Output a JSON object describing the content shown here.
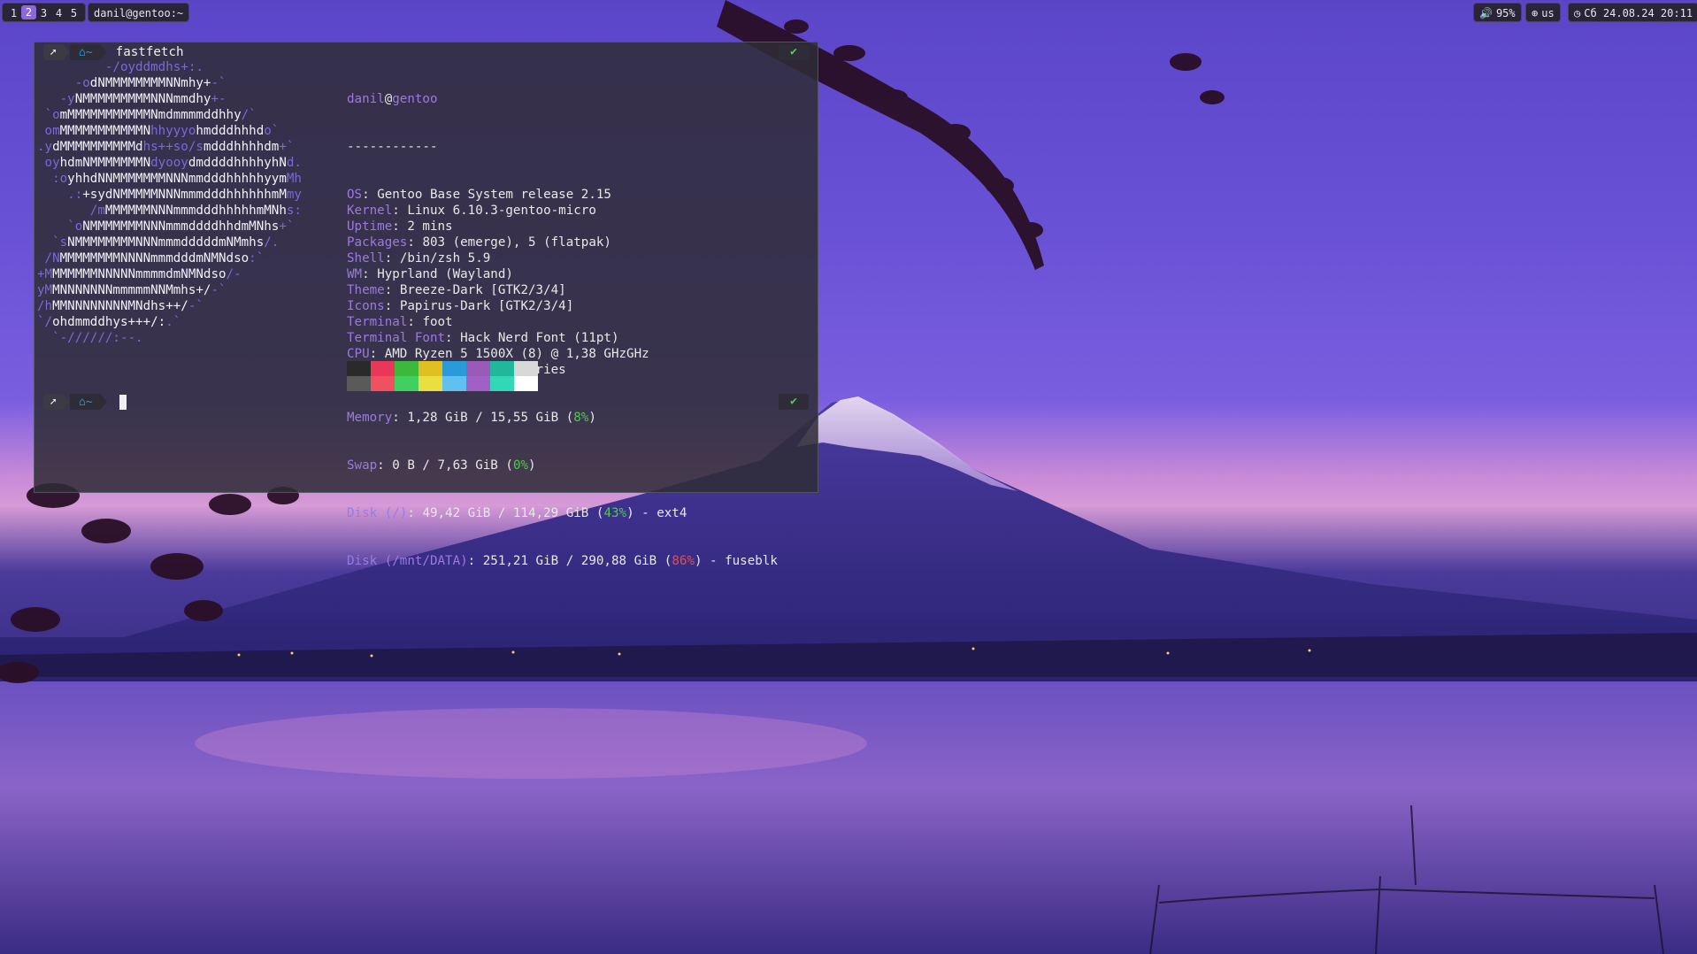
{
  "topbar": {
    "workspaces": [
      "1",
      "2",
      "3",
      "4",
      "5"
    ],
    "active_workspace": "2",
    "window_title": "danil@gentoo:~",
    "volume": "95%",
    "keyboard_layout": "us",
    "clock": "Сб 24.08.24 20:11",
    "icons": {
      "volume": "speaker-icon",
      "keyboard": "globe-icon",
      "clock": "clock-icon"
    }
  },
  "terminal": {
    "command": "fastfetch",
    "prompt_home": "~",
    "user_host": {
      "user": "danil",
      "at": "@",
      "host": "gentoo"
    },
    "separator": "------------",
    "info": [
      {
        "key": "OS",
        "value": "Gentoo Base System release 2.15"
      },
      {
        "key": "Kernel",
        "value": "Linux 6.10.3-gentoo-micro"
      },
      {
        "key": "Uptime",
        "value": "2 mins"
      },
      {
        "key": "Packages",
        "value": "803 (emerge), 5 (flatpak)"
      },
      {
        "key": "Shell",
        "value": "/bin/zsh 5.9"
      },
      {
        "key": "WM",
        "value": "Hyprland (Wayland)"
      },
      {
        "key": "Theme",
        "value": "Breeze-Dark [GTK2/3/4]"
      },
      {
        "key": "Icons",
        "value": "Papirus-Dark [GTK2/3/4]"
      },
      {
        "key": "Terminal",
        "value": "foot"
      },
      {
        "key": "Terminal Font",
        "value": "Hack Nerd Font (11pt)"
      },
      {
        "key": "CPU",
        "value": "AMD Ryzen 5 1500X (8) @ 1,38 GHzGHz"
      },
      {
        "key": "GPU",
        "value": "AMD Radeon RX 570 Series"
      }
    ],
    "memory": {
      "key": "Memory",
      "pre": "1,28 GiB / 15,55 GiB (",
      "pct": "8%",
      "post": ")"
    },
    "swap": {
      "key": "Swap",
      "pre": "0 B / 7,63 GiB (",
      "pct": "0%",
      "post": ")"
    },
    "disk_root": {
      "key": "Disk (/)",
      "pre": "49,42 GiB / 114,29 GiB (",
      "pct": "43%",
      "post": ") - ext4"
    },
    "disk_data": {
      "key": "Disk (/mnt/DATA)",
      "pre": "251,21 GiB / 290,88 GiB (",
      "pct": "86%",
      "post": ") - fuseblk"
    },
    "palette": {
      "top": [
        "#2a2a2a",
        "#e8385a",
        "#3cb83c",
        "#e0c020",
        "#2a9ad8",
        "#9a5ab8",
        "#20b89a",
        "#d8d8d8"
      ],
      "bottom": [
        "#5a5a5a",
        "#f05060",
        "#40d060",
        "#e8e040",
        "#60c0f0",
        "#a060c8",
        "#30d8b8",
        "#ffffff"
      ]
    },
    "logo_lines": [
      [
        [
          "         -/oyddmdhs+:.",
          "p"
        ]
      ],
      [
        [
          "     -o",
          "p"
        ],
        [
          "dNMMMMMMMMNNmhy+",
          "w"
        ],
        [
          "-`",
          "p"
        ]
      ],
      [
        [
          "   -y",
          "p"
        ],
        [
          "NMMMMMMMMMNNNmmdhy",
          "w"
        ],
        [
          "+-",
          "p"
        ]
      ],
      [
        [
          " `o",
          "p"
        ],
        [
          "mMMMMMMMMMMMNmdmmmmddhhy",
          "w"
        ],
        [
          "/`",
          "p"
        ]
      ],
      [
        [
          " om",
          "p"
        ],
        [
          "MMMMMMMMMMMN",
          "w"
        ],
        [
          "hhyyyo",
          "p"
        ],
        [
          "hmdddhhhd",
          "w"
        ],
        [
          "o`",
          "p"
        ]
      ],
      [
        [
          ".y",
          "p"
        ],
        [
          "dMMMMMMMMMMd",
          "w"
        ],
        [
          "hs++so/s",
          "p"
        ],
        [
          "mdddhhhhdm",
          "w"
        ],
        [
          "+`",
          "p"
        ]
      ],
      [
        [
          " oy",
          "p"
        ],
        [
          "hdmNMMMMMMMN",
          "w"
        ],
        [
          "dyooy",
          "p"
        ],
        [
          "dmddddhhhhyhN",
          "w"
        ],
        [
          "d.",
          "p"
        ]
      ],
      [
        [
          "  :o",
          "p"
        ],
        [
          "yhhdNNMMMMMMMNNNmmdddhhhhhyym",
          "w"
        ],
        [
          "Mh",
          "p"
        ]
      ],
      [
        [
          "    .:",
          "p"
        ],
        [
          "+sydNMMMMMNNNmmmdddhhhhhhmM",
          "w"
        ],
        [
          "my",
          "p"
        ]
      ],
      [
        [
          "       /m",
          "p"
        ],
        [
          "MMMMMMNNNmmmdddhhhhhmMNh",
          "w"
        ],
        [
          "s:",
          "p"
        ]
      ],
      [
        [
          "    `o",
          "p"
        ],
        [
          "NMMMMMMMNNNmmmddddhhdmMNhs",
          "w"
        ],
        [
          "+`",
          "p"
        ]
      ],
      [
        [
          "  `s",
          "p"
        ],
        [
          "NMMMMMMMMNNNmmmdddddmNMmhs",
          "w"
        ],
        [
          "/.",
          "p"
        ]
      ],
      [
        [
          " /N",
          "p"
        ],
        [
          "MMMMMMMMNNNNmmmdddmNMNdso",
          "w"
        ],
        [
          ":`",
          "p"
        ]
      ],
      [
        [
          "+M",
          "p"
        ],
        [
          "MMMMMMNNNNNmmmmdmNMNdso",
          "w"
        ],
        [
          "/-",
          "p"
        ]
      ],
      [
        [
          "yM",
          "p"
        ],
        [
          "MNNNNNNNmmmmmNNMmhs+/",
          "w"
        ],
        [
          "-`",
          "p"
        ]
      ],
      [
        [
          "/h",
          "p"
        ],
        [
          "MMNNNNNNNNMNdhs++/",
          "w"
        ],
        [
          "-`",
          "p"
        ]
      ],
      [
        [
          "`/",
          "p"
        ],
        [
          "ohdmmddhys+++/:",
          "w"
        ],
        [
          ".`",
          "p"
        ]
      ],
      [
        [
          "  `-//////:--.",
          "p"
        ]
      ]
    ]
  }
}
